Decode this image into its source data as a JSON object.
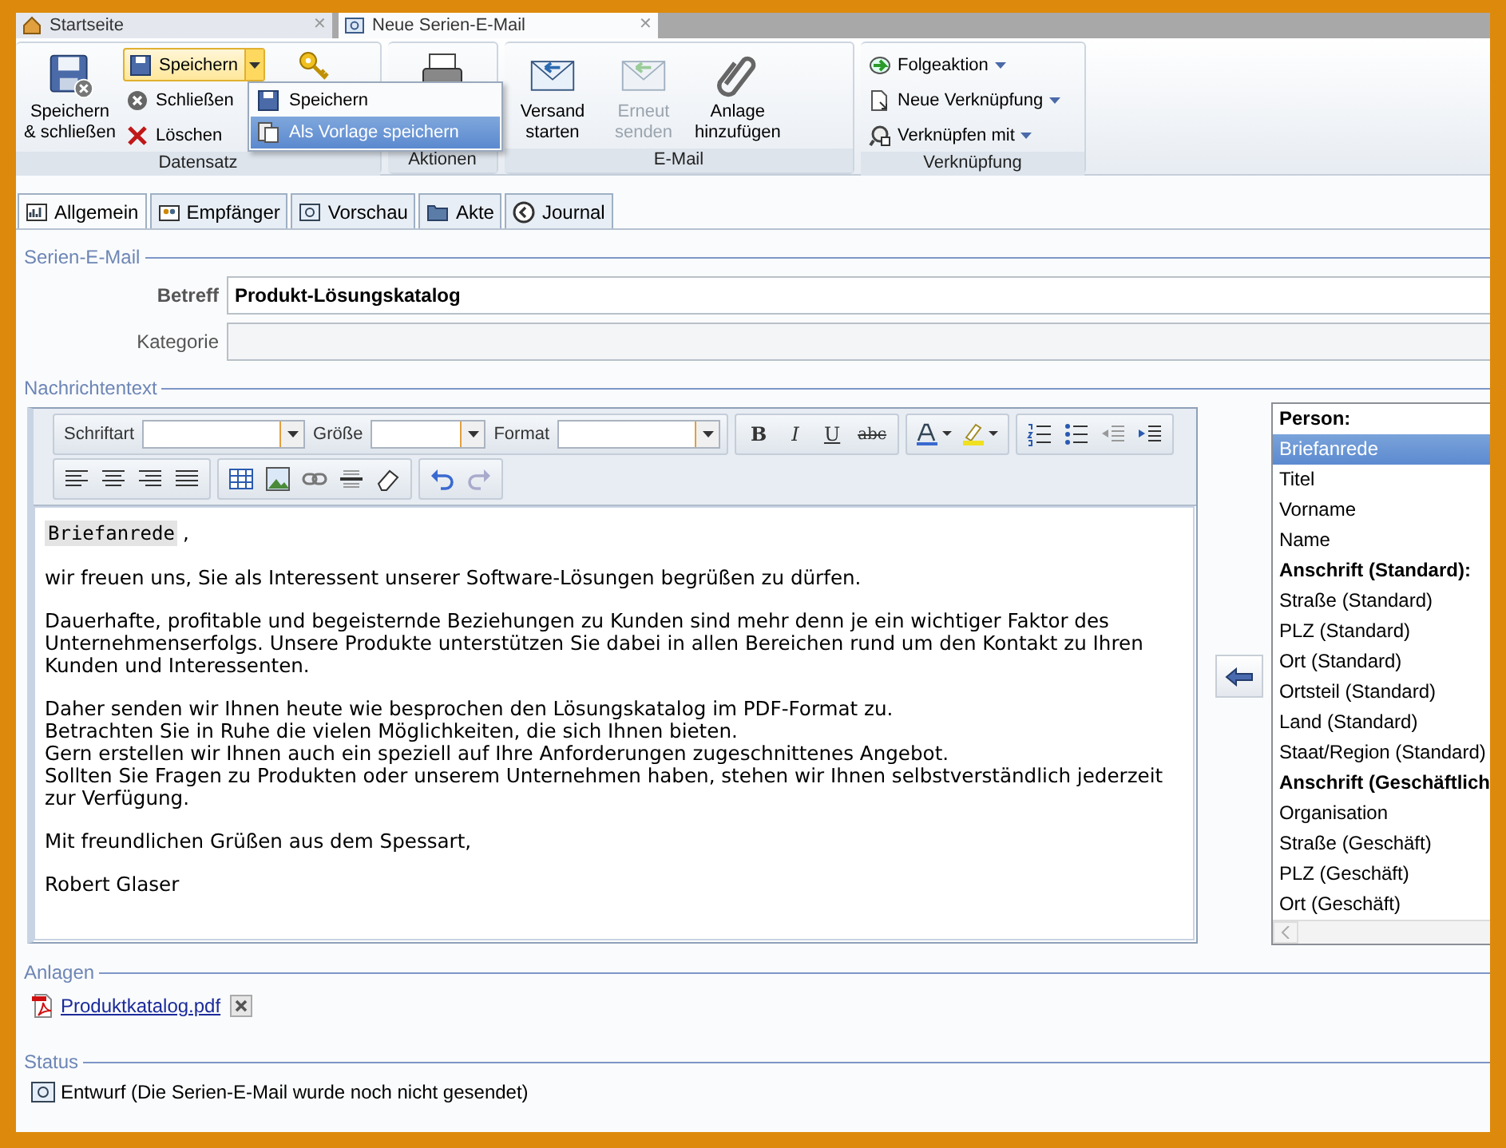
{
  "doc_tabs": [
    {
      "label": "Startseite",
      "close": "✕",
      "selected": false
    },
    {
      "label": "Neue Serien-E-Mail",
      "close": "✕",
      "selected": true
    }
  ],
  "ribbon": {
    "groups": [
      {
        "label": "Datensatz",
        "columns": [
          [
            {
              "kind": "large",
              "label": "Speichern\n& schließen",
              "disabled": false
            }
          ],
          [
            {
              "kind": "split",
              "label": "Speichern",
              "disabled": false
            },
            {
              "kind": "small",
              "label": "Schließen",
              "disabled": false
            },
            {
              "kind": "small",
              "label": "Löschen",
              "disabled": false
            }
          ],
          [
            {
              "kind": "icon"
            }
          ]
        ]
      },
      {
        "label": "Aktionen",
        "columns": [
          [
            {
              "kind": "icon"
            }
          ]
        ]
      },
      {
        "label": "E-Mail",
        "columns": [
          [
            {
              "kind": "large",
              "label": "Versand\nstarten",
              "disabled": false
            }
          ],
          [
            {
              "kind": "large",
              "label": "Erneut\nsenden",
              "disabled": true
            }
          ],
          [
            {
              "kind": "large",
              "label": "Anlage\nhinzufügen",
              "disabled": false
            }
          ]
        ]
      },
      {
        "label": "Verknüpfung",
        "columns": [
          [
            {
              "kind": "menu",
              "label": "Folgeaktion",
              "disabled": false
            },
            {
              "kind": "menu",
              "label": "Neue Verknüpfung",
              "disabled": false
            },
            {
              "kind": "menu",
              "label": "Verknüpfen mit",
              "disabled": false
            }
          ]
        ]
      }
    ],
    "save_menu": [
      {
        "label": "Speichern",
        "selected": false
      },
      {
        "label": "Als Vorlage speichern",
        "selected": true
      }
    ]
  },
  "tabs": [
    {
      "label": "Allgemein",
      "selected": true
    },
    {
      "label": "Empfänger",
      "selected": false
    },
    {
      "label": "Vorschau",
      "selected": false
    },
    {
      "label": "Akte",
      "selected": false
    },
    {
      "label": "Journal",
      "selected": false
    }
  ],
  "form": {
    "section": "Serien-E-Mail",
    "fields": [
      {
        "label": "Betreff",
        "value": "Produkt-Lösungskatalog"
      },
      {
        "label": "Kategorie"
      }
    ]
  },
  "message": {
    "section": "Nachrichtentext",
    "toolbar": {
      "combos": [
        {
          "label": "Schriftart"
        },
        {
          "label": "Größe"
        },
        {
          "label": "Format"
        }
      ],
      "format_buttons": [
        {
          "label": "B",
          "kind": "bold"
        },
        {
          "label": "I",
          "kind": "italic"
        },
        {
          "label": "U",
          "kind": "underline"
        },
        {
          "label": "abc",
          "kind": "strike"
        }
      ]
    },
    "salutation_field": "Briefanrede",
    "salutation_suffix": ",",
    "paragraphs": [
      [
        "wir freuen uns, Sie als Interessent unserer Software-Lösungen begrüßen zu dürfen."
      ],
      [
        "Dauerhafte, profitable und begeisternde Beziehungen zu Kunden sind mehr denn je ein wichtiger Faktor des",
        "Unternehmenserfolgs. Unsere Produkte unterstützen Sie dabei in allen Bereichen rund um den Kontakt zu Ihren",
        "Kunden und Interessenten."
      ],
      [
        "Daher senden wir Ihnen heute wie besprochen den Lösungskatalog im PDF-Format zu.",
        "Betrachten Sie in Ruhe die vielen Möglichkeiten, die sich Ihnen bieten.",
        "Gern erstellen wir Ihnen auch ein speziell auf Ihre Anforderungen zugeschnittenes Angebot.",
        "Sollten Sie Fragen zu Produkten oder unserem Unternehmen haben, stehen wir Ihnen selbstverständlich jederzeit",
        "zur Verfügung."
      ],
      [
        "Mit freundlichen Grüßen aus dem Spessart,"
      ],
      [
        "Robert Glaser"
      ]
    ],
    "fields_list": [
      {
        "label": "Person:",
        "kind": "header",
        "selected": false
      },
      {
        "label": "Briefanrede",
        "kind": "field",
        "selected": true
      },
      {
        "label": "Titel",
        "kind": "field",
        "selected": false
      },
      {
        "label": "Vorname",
        "kind": "field",
        "selected": false
      },
      {
        "label": "Name",
        "kind": "field",
        "selected": false
      },
      {
        "label": "Anschrift (Standard):",
        "kind": "header",
        "selected": false
      },
      {
        "label": "Straße (Standard)",
        "kind": "field",
        "selected": false
      },
      {
        "label": "PLZ (Standard)",
        "kind": "field",
        "selected": false
      },
      {
        "label": "Ort (Standard)",
        "kind": "field",
        "selected": false
      },
      {
        "label": "Ortsteil (Standard)",
        "kind": "field",
        "selected": false
      },
      {
        "label": "Land (Standard)",
        "kind": "field",
        "selected": false
      },
      {
        "label": "Staat/Region (Standard)",
        "kind": "field",
        "selected": false
      },
      {
        "label": "Anschrift (Geschäftlich",
        "kind": "header",
        "selected": false
      },
      {
        "label": "Organisation",
        "kind": "field",
        "selected": false
      },
      {
        "label": "Straße (Geschäft)",
        "kind": "field",
        "selected": false
      },
      {
        "label": "PLZ (Geschäft)",
        "kind": "field",
        "selected": false
      },
      {
        "label": "Ort (Geschäft)",
        "kind": "field",
        "selected": false
      }
    ]
  },
  "attachments": {
    "section": "Anlagen",
    "files": [
      {
        "name": "Produktkatalog.pdf"
      }
    ]
  },
  "status": {
    "section": "Status",
    "text": "Entwurf (Die Serien-E-Mail wurde noch nicht gesendet)"
  }
}
